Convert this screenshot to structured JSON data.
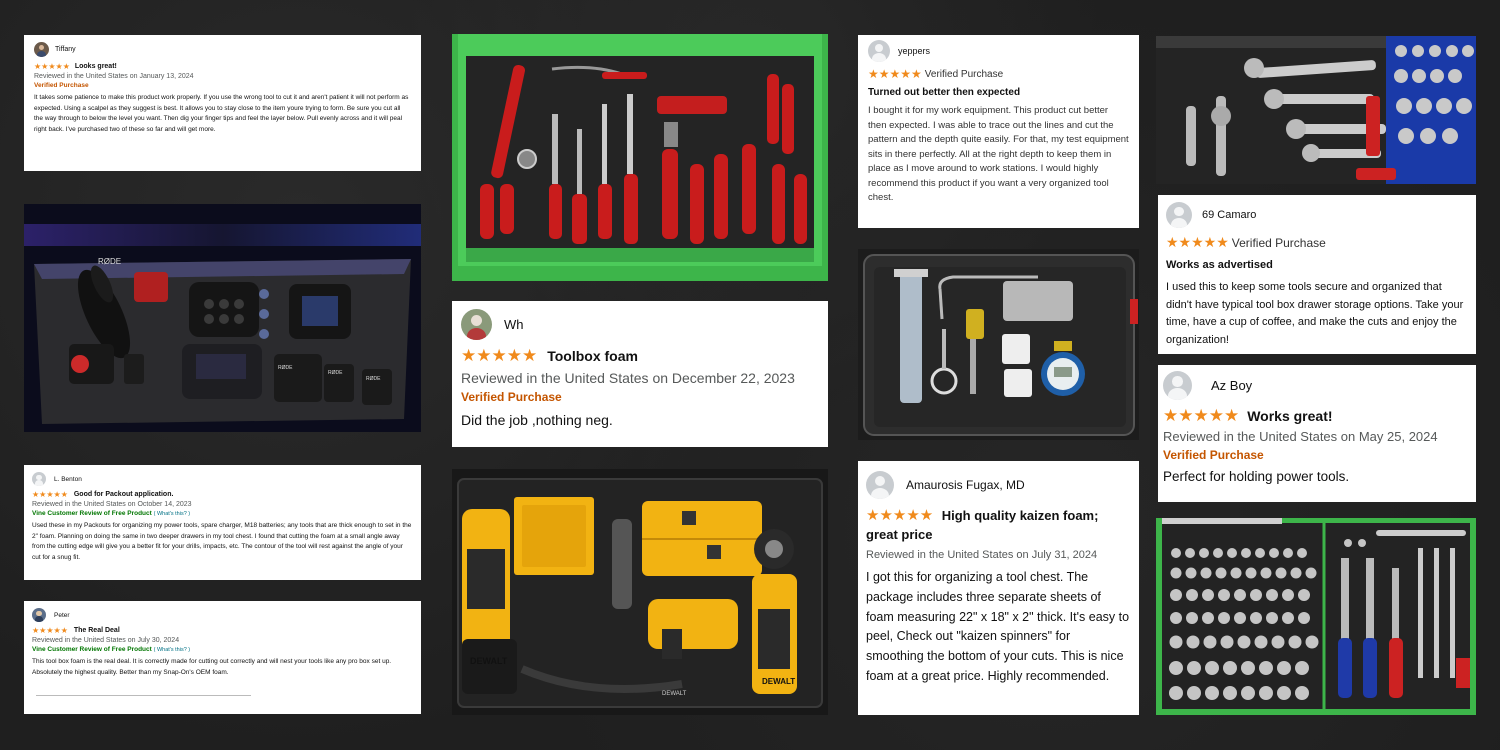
{
  "colors": {
    "background": "#1f1f1f",
    "star": "#f08a1c",
    "verified": "#c45500",
    "vine": "#007600",
    "link": "#007185",
    "drawer_green": "#3db54a",
    "foam": "#2a2a2a"
  },
  "reviews": {
    "tiffany": {
      "name": "Tiffany",
      "stars": "★★★★★",
      "title": "Looks great!",
      "reviewed": "Reviewed in the United States on January 13, 2024",
      "verified": "Verified Purchase",
      "body": "It takes some patience to make this product work properly. If you use the wrong tool to cut it and aren't patient it will not perform as expected. Using a scalpel as they suggest is best. It allows you to stay close to the item youre trying to form. Be sure you cut all the way through to below the level you want. Then dig your finger tips and feel the layer below. Pull evenly across and it will peal right back. I've purchased two of these so far and will get more."
    },
    "benton": {
      "name": "L. Benton",
      "stars": "★★★★★",
      "title": "Good for Packout application.",
      "reviewed": "Reviewed in the United States on October 14, 2023",
      "vine": "Vine Customer Review of Free Product",
      "whats": "( What's this? )",
      "body": "Used these in my Packouts for organizing my power tools, spare charger, M18 batteries; any tools that are thick enough to set in the 2\" foam. Planning on doing the same in two deeper drawers in my tool chest. I found that cutting the foam at a small angle away from the cutting edge will give you a better fit for your drills, impacts, etc. The contour of the tool will rest against the angle of your cut for a snug fit."
    },
    "peter": {
      "name": "Peter",
      "stars": "★★★★★",
      "title": "The Real Deal",
      "reviewed": "Reviewed in the United States on July 30, 2024",
      "vine": "Vine Customer Review of Free Product",
      "whats": "( What's this? )",
      "body": "This tool box foam is the real deal. It is correctly made for cutting out correctly and will nest your tools like any pro box set up. Absolutely the highest quality. Better than my Snap-On's OEM foam."
    },
    "wh": {
      "name": "Wh",
      "stars": "★★★★★",
      "title": "Toolbox foam",
      "reviewed": "Reviewed in the United States on December 22, 2023",
      "verified": "Verified Purchase",
      "body": "Did the job ,nothing neg."
    },
    "yeppers": {
      "name": "yeppers",
      "stars": "★★★★★",
      "verified": "Verified Purchase",
      "title": "Turned out better then expected",
      "body": "I bought it for my work equipment. This product cut better then expected. I was able to trace out the lines and cut the pattern and the depth quite easily. For that, my test equipment sits in there perfectly. All at the right depth to keep them in place as I move around to work stations. I would highly recommend this product if you want a very organized tool chest."
    },
    "amaurosis": {
      "name": "Amaurosis Fugax, MD",
      "stars": "★★★★★",
      "title": "High quality kaizen foam; great price",
      "reviewed": "Reviewed in the United States on July 31, 2024",
      "body": "I got this for organizing a tool chest. The package includes three separate sheets of foam measuring 22\" x 18\" x 2\" thick. It's easy to peel, Check out \"kaizen spinners\" for smoothing the bottom of your cuts. This is nice foam at a great price. Highly recommended."
    },
    "camaro": {
      "name": "69 Camaro",
      "stars": "★★★★★",
      "verified": "Verified Purchase",
      "title": "Works as advertised",
      "body": "I used this to keep some tools secure and organized that didn't have typical tool box drawer storage options. Take your time, have a cup of coffee, and make the cuts and enjoy the organization!"
    },
    "azboy": {
      "name": "Az Boy",
      "stars": "★★★★★",
      "title": "Works great!",
      "reviewed": "Reviewed in the United States on May 25, 2024",
      "verified": "Verified Purchase",
      "body": "Perfect for holding power tools."
    }
  },
  "photos": {
    "rode": {
      "brand_1": "RØDE",
      "brand_2": "RØDE",
      "brand_3": "RØDE",
      "brand_4": "RØDE"
    },
    "power": {
      "brand_1": "DEWALT",
      "brand_2": "DEWALT",
      "brand_3": "DEWALT"
    }
  }
}
